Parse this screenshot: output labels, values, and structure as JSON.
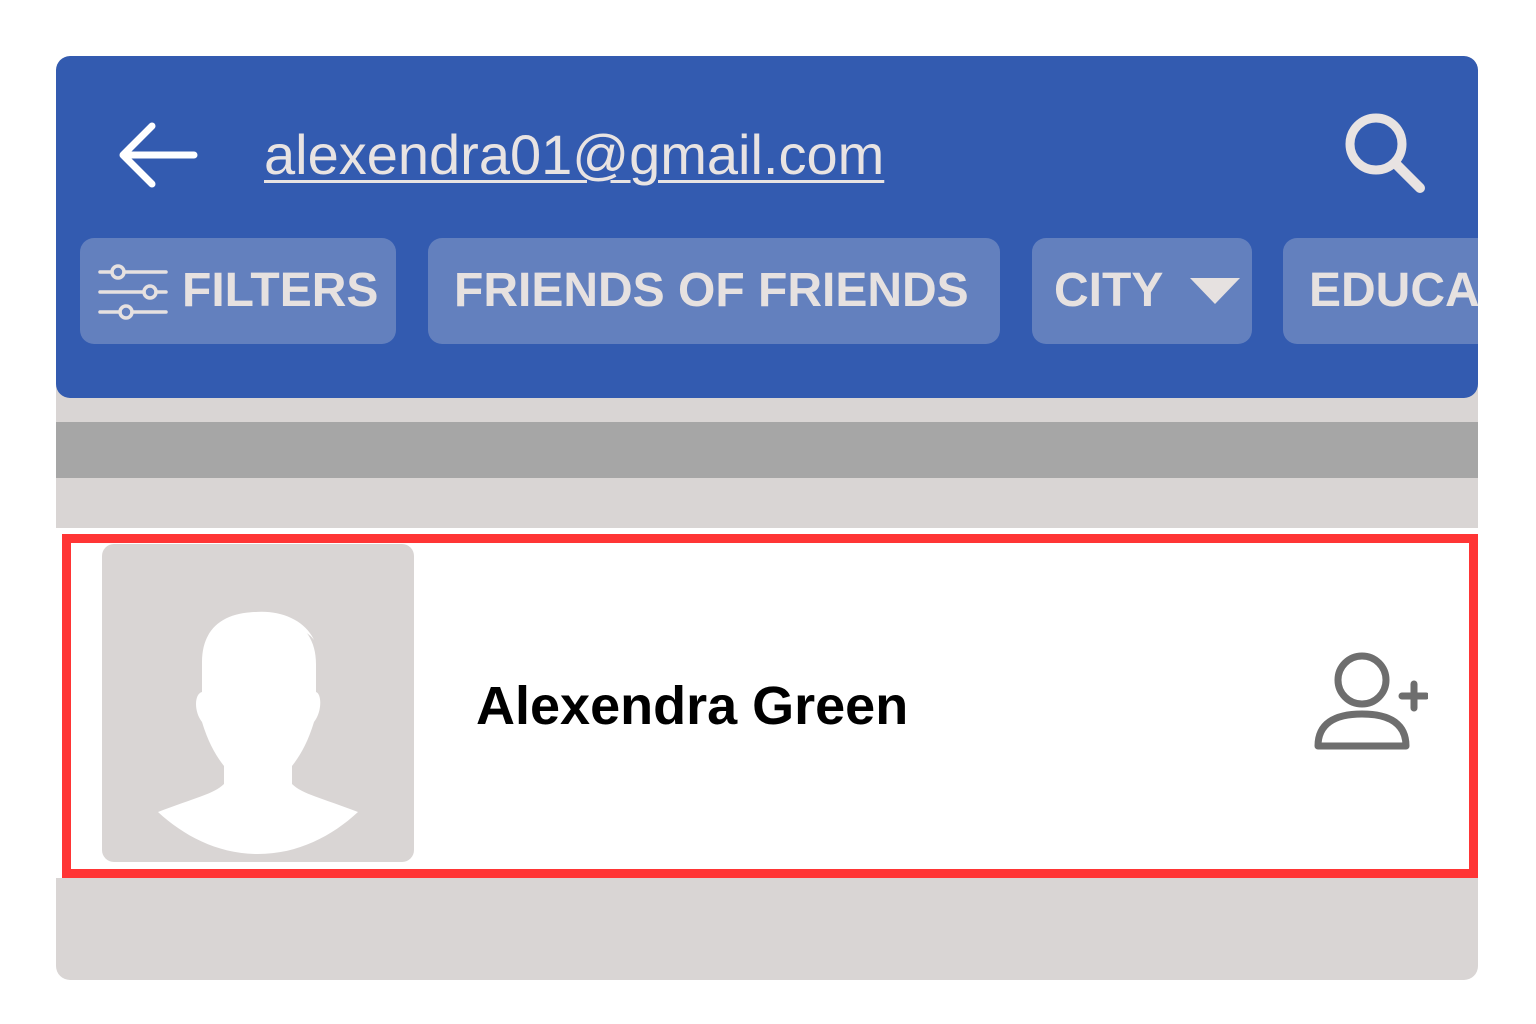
{
  "header": {
    "back_icon": "arrow-left-icon",
    "search_query": "alexendra01@gmail.com",
    "search_icon": "magnifier-icon"
  },
  "filters": {
    "chips": [
      {
        "label": "FILTERS",
        "icon": "sliders-icon"
      },
      {
        "label": "FRIENDS OF FRIENDS"
      },
      {
        "label": "CITY",
        "icon": "dropdown-triangle-icon"
      },
      {
        "label": "EDUCA"
      }
    ]
  },
  "results": [
    {
      "name": "Alexendra Green",
      "avatar_icon": "person-silhouette-icon",
      "action_icon": "add-friend-icon",
      "highlighted": true
    }
  ],
  "colors": {
    "header_bg": "#335bb0",
    "chip_bg": "#6380be",
    "chip_text": "#e6e1e0",
    "page_bg": "#d9d5d4",
    "divider": "#a6a6a6",
    "highlight": "#ff3535",
    "icon_gray": "#6e6e6e"
  }
}
